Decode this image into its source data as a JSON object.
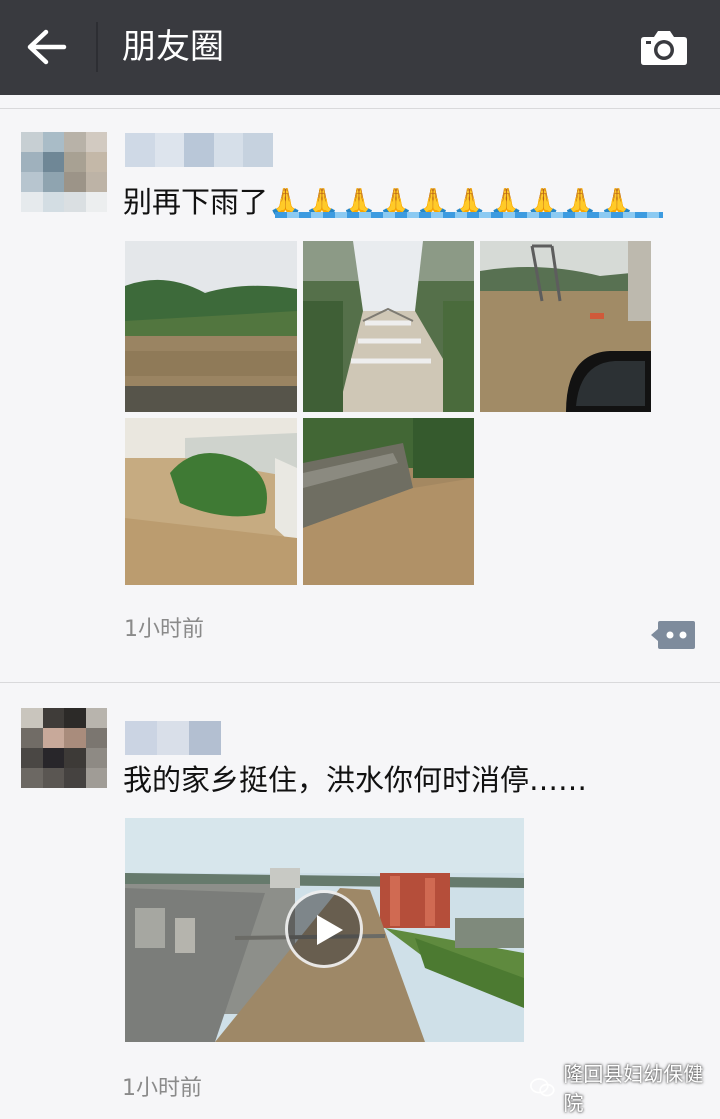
{
  "header": {
    "title": "朋友圈",
    "background": "#393a3f"
  },
  "posts": [
    {
      "text": "别再下雨了",
      "emoji": "🙏🙏🙏🙏🙏🙏🙏🙏🙏🙏",
      "time": "1小时前",
      "photos_count": 5
    },
    {
      "text": "我的家乡挺住，洪水你何时消停……",
      "time": "1小时前",
      "media": "video"
    }
  ],
  "watermark": {
    "text": "隆回县妇幼保健院"
  },
  "icons": [
    "back-arrow-icon",
    "camera-icon",
    "comment-icon",
    "play-icon",
    "wechat-logo-icon"
  ]
}
